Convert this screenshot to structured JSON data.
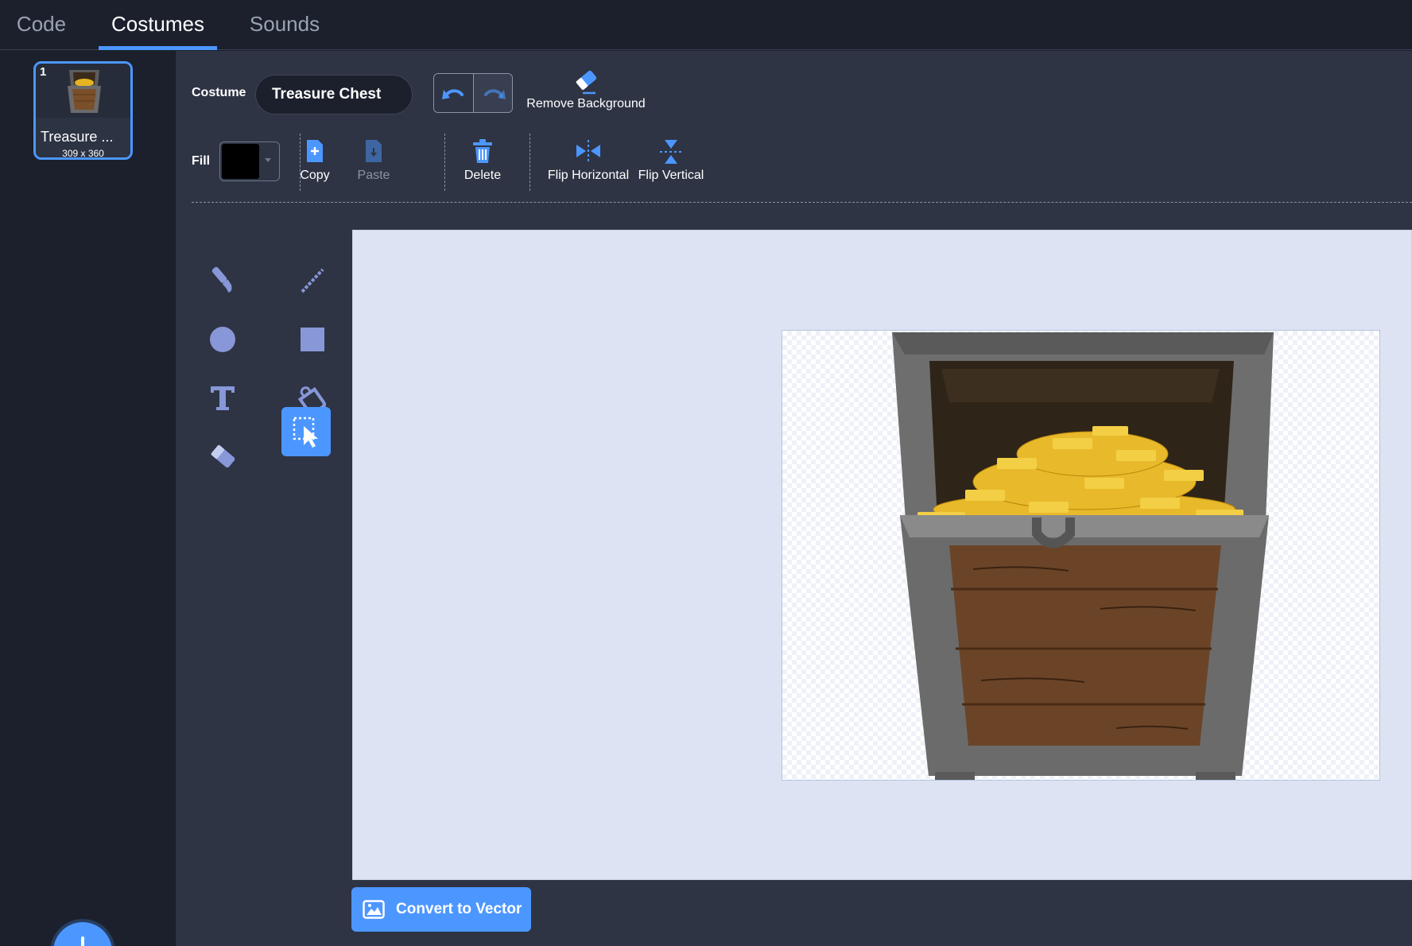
{
  "tabs": [
    {
      "label": "Code",
      "active": false
    },
    {
      "label": "Costumes",
      "active": true
    },
    {
      "label": "Sounds",
      "active": false
    }
  ],
  "costume_list": {
    "items": [
      {
        "number": "1",
        "name": "Treasure ...",
        "size": "309 x 360",
        "selected": true
      }
    ],
    "add_button_icon": "plus-icon"
  },
  "toolbar": {
    "costume_label": "Costume",
    "costume_name": "Treasure Chest",
    "undo_icon": "undo-icon",
    "redo_icon": "redo-icon",
    "remove_background_label": "Remove Background",
    "fill_label": "Fill",
    "fill_color": "#000000",
    "copy_label": "Copy",
    "paste_label": "Paste",
    "delete_label": "Delete",
    "flip_horizontal_label": "Flip Horizontal",
    "flip_vertical_label": "Flip Vertical"
  },
  "tools": [
    {
      "name": "brush",
      "icon": "brush-icon",
      "selected": false
    },
    {
      "name": "line",
      "icon": "line-icon",
      "selected": false
    },
    {
      "name": "circle",
      "icon": "circle-icon",
      "selected": false
    },
    {
      "name": "rectangle",
      "icon": "rectangle-icon",
      "selected": false
    },
    {
      "name": "text",
      "icon": "text-icon",
      "selected": false
    },
    {
      "name": "fill",
      "icon": "fill-bucket-icon",
      "selected": false
    },
    {
      "name": "eraser",
      "icon": "eraser-icon",
      "selected": false
    },
    {
      "name": "select",
      "icon": "select-icon",
      "selected": true
    }
  ],
  "convert_button_label": "Convert to Vector",
  "colors": {
    "accent": "#4c97ff",
    "background": "#1b202c",
    "panel": "#2e3444",
    "canvas": "#dde3f2"
  }
}
